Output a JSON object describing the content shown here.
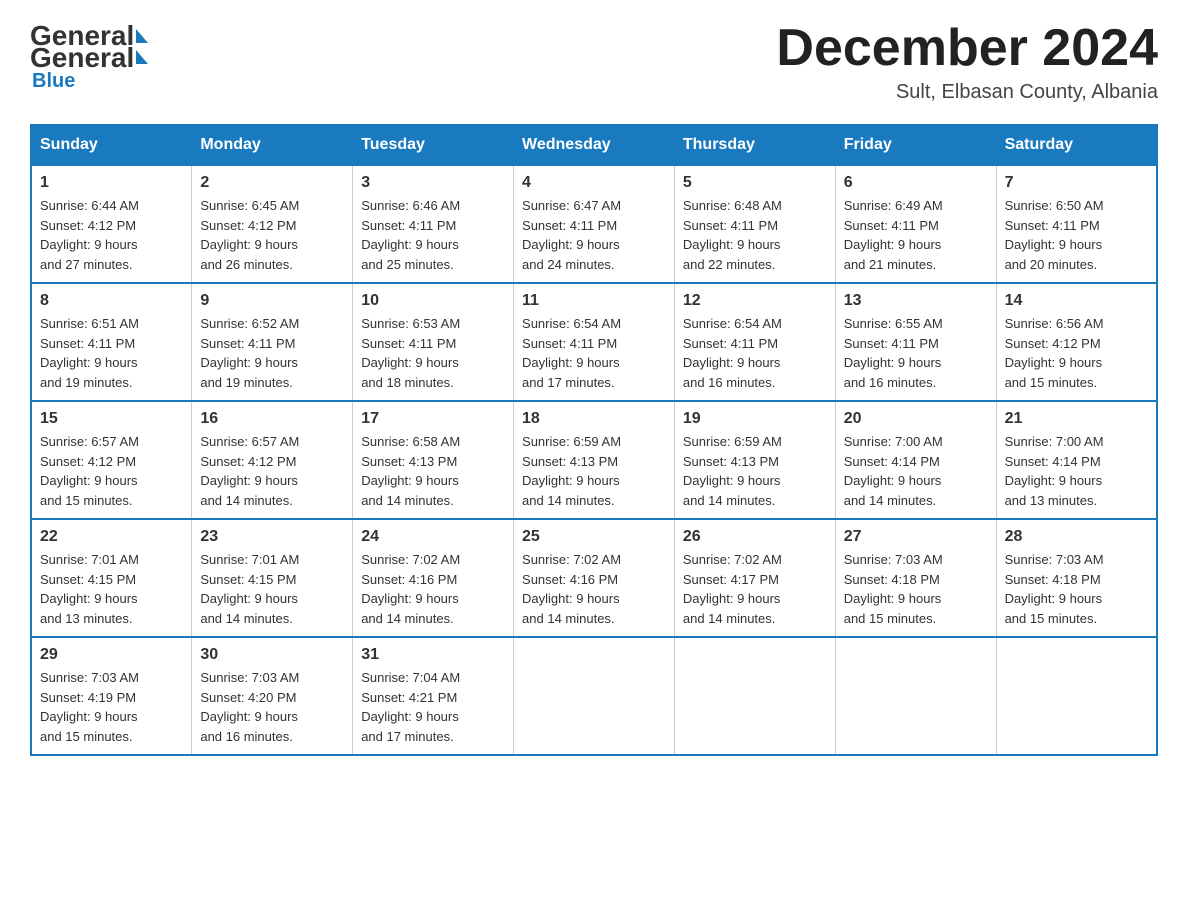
{
  "header": {
    "logo_general": "General",
    "logo_blue": "Blue",
    "month_title": "December 2024",
    "location": "Sult, Elbasan County, Albania"
  },
  "weekdays": [
    "Sunday",
    "Monday",
    "Tuesday",
    "Wednesday",
    "Thursday",
    "Friday",
    "Saturday"
  ],
  "weeks": [
    [
      {
        "day": "1",
        "sunrise": "6:44 AM",
        "sunset": "4:12 PM",
        "daylight": "9 hours and 27 minutes."
      },
      {
        "day": "2",
        "sunrise": "6:45 AM",
        "sunset": "4:12 PM",
        "daylight": "9 hours and 26 minutes."
      },
      {
        "day": "3",
        "sunrise": "6:46 AM",
        "sunset": "4:11 PM",
        "daylight": "9 hours and 25 minutes."
      },
      {
        "day": "4",
        "sunrise": "6:47 AM",
        "sunset": "4:11 PM",
        "daylight": "9 hours and 24 minutes."
      },
      {
        "day": "5",
        "sunrise": "6:48 AM",
        "sunset": "4:11 PM",
        "daylight": "9 hours and 22 minutes."
      },
      {
        "day": "6",
        "sunrise": "6:49 AM",
        "sunset": "4:11 PM",
        "daylight": "9 hours and 21 minutes."
      },
      {
        "day": "7",
        "sunrise": "6:50 AM",
        "sunset": "4:11 PM",
        "daylight": "9 hours and 20 minutes."
      }
    ],
    [
      {
        "day": "8",
        "sunrise": "6:51 AM",
        "sunset": "4:11 PM",
        "daylight": "9 hours and 19 minutes."
      },
      {
        "day": "9",
        "sunrise": "6:52 AM",
        "sunset": "4:11 PM",
        "daylight": "9 hours and 19 minutes."
      },
      {
        "day": "10",
        "sunrise": "6:53 AM",
        "sunset": "4:11 PM",
        "daylight": "9 hours and 18 minutes."
      },
      {
        "day": "11",
        "sunrise": "6:54 AM",
        "sunset": "4:11 PM",
        "daylight": "9 hours and 17 minutes."
      },
      {
        "day": "12",
        "sunrise": "6:54 AM",
        "sunset": "4:11 PM",
        "daylight": "9 hours and 16 minutes."
      },
      {
        "day": "13",
        "sunrise": "6:55 AM",
        "sunset": "4:11 PM",
        "daylight": "9 hours and 16 minutes."
      },
      {
        "day": "14",
        "sunrise": "6:56 AM",
        "sunset": "4:12 PM",
        "daylight": "9 hours and 15 minutes."
      }
    ],
    [
      {
        "day": "15",
        "sunrise": "6:57 AM",
        "sunset": "4:12 PM",
        "daylight": "9 hours and 15 minutes."
      },
      {
        "day": "16",
        "sunrise": "6:57 AM",
        "sunset": "4:12 PM",
        "daylight": "9 hours and 14 minutes."
      },
      {
        "day": "17",
        "sunrise": "6:58 AM",
        "sunset": "4:13 PM",
        "daylight": "9 hours and 14 minutes."
      },
      {
        "day": "18",
        "sunrise": "6:59 AM",
        "sunset": "4:13 PM",
        "daylight": "9 hours and 14 minutes."
      },
      {
        "day": "19",
        "sunrise": "6:59 AM",
        "sunset": "4:13 PM",
        "daylight": "9 hours and 14 minutes."
      },
      {
        "day": "20",
        "sunrise": "7:00 AM",
        "sunset": "4:14 PM",
        "daylight": "9 hours and 14 minutes."
      },
      {
        "day": "21",
        "sunrise": "7:00 AM",
        "sunset": "4:14 PM",
        "daylight": "9 hours and 13 minutes."
      }
    ],
    [
      {
        "day": "22",
        "sunrise": "7:01 AM",
        "sunset": "4:15 PM",
        "daylight": "9 hours and 13 minutes."
      },
      {
        "day": "23",
        "sunrise": "7:01 AM",
        "sunset": "4:15 PM",
        "daylight": "9 hours and 14 minutes."
      },
      {
        "day": "24",
        "sunrise": "7:02 AM",
        "sunset": "4:16 PM",
        "daylight": "9 hours and 14 minutes."
      },
      {
        "day": "25",
        "sunrise": "7:02 AM",
        "sunset": "4:16 PM",
        "daylight": "9 hours and 14 minutes."
      },
      {
        "day": "26",
        "sunrise": "7:02 AM",
        "sunset": "4:17 PM",
        "daylight": "9 hours and 14 minutes."
      },
      {
        "day": "27",
        "sunrise": "7:03 AM",
        "sunset": "4:18 PM",
        "daylight": "9 hours and 15 minutes."
      },
      {
        "day": "28",
        "sunrise": "7:03 AM",
        "sunset": "4:18 PM",
        "daylight": "9 hours and 15 minutes."
      }
    ],
    [
      {
        "day": "29",
        "sunrise": "7:03 AM",
        "sunset": "4:19 PM",
        "daylight": "9 hours and 15 minutes."
      },
      {
        "day": "30",
        "sunrise": "7:03 AM",
        "sunset": "4:20 PM",
        "daylight": "9 hours and 16 minutes."
      },
      {
        "day": "31",
        "sunrise": "7:04 AM",
        "sunset": "4:21 PM",
        "daylight": "9 hours and 17 minutes."
      },
      null,
      null,
      null,
      null
    ]
  ],
  "labels": {
    "sunrise": "Sunrise:",
    "sunset": "Sunset:",
    "daylight": "Daylight:"
  }
}
